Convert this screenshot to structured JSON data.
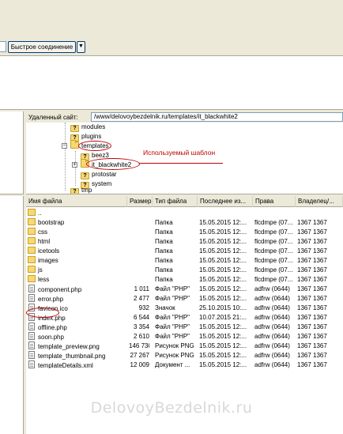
{
  "toolbar": {
    "quick_connect_label": "Быстрое соединение",
    "dropdown_glyph": "▼"
  },
  "remote": {
    "label": "Удаленный сайт:",
    "path": "/www/delovoybezdelnik.ru/templates/it_blackwhite2"
  },
  "tree": [
    {
      "label": "modules",
      "icon": "question-folder-icon"
    },
    {
      "label": "plugins",
      "icon": "question-folder-icon"
    },
    {
      "label": "templates",
      "icon": "folder-icon",
      "expanded": true
    },
    {
      "label": "beez3",
      "icon": "question-folder-icon"
    },
    {
      "label": "it_blackwhite2",
      "icon": "folder-icon",
      "expandable": true
    },
    {
      "label": "protostar",
      "icon": "question-folder-icon"
    },
    {
      "label": "system",
      "icon": "question-folder-icon"
    },
    {
      "label": "tmp",
      "icon": "question-folder-icon"
    }
  ],
  "annotation": "Используемый шаблон",
  "columns": [
    "Имя файла",
    "Размер",
    "Тип файла",
    "Последнее из...",
    "Права",
    "Владелец/..."
  ],
  "files": [
    {
      "name": "..",
      "size": "",
      "type": "",
      "date": "",
      "perm": "",
      "owner": "",
      "kind": "up"
    },
    {
      "name": "bootstrap",
      "size": "",
      "type": "Папка",
      "date": "15.05.2015 12:...",
      "perm": "flcdmpe (07...",
      "owner": "1367 1367",
      "kind": "folder"
    },
    {
      "name": "css",
      "size": "",
      "type": "Папка",
      "date": "15.05.2015 12:...",
      "perm": "flcdmpe (07...",
      "owner": "1367 1367",
      "kind": "folder"
    },
    {
      "name": "html",
      "size": "",
      "type": "Папка",
      "date": "15.05.2015 12:...",
      "perm": "flcdmpe (07...",
      "owner": "1367 1367",
      "kind": "folder"
    },
    {
      "name": "icetools",
      "size": "",
      "type": "Папка",
      "date": "15.05.2015 12:...",
      "perm": "flcdmpe (07...",
      "owner": "1367 1367",
      "kind": "folder"
    },
    {
      "name": "images",
      "size": "",
      "type": "Папка",
      "date": "15.05.2015 12:...",
      "perm": "flcdmpe (07...",
      "owner": "1367 1367",
      "kind": "folder"
    },
    {
      "name": "js",
      "size": "",
      "type": "Папка",
      "date": "15.05.2015 12:...",
      "perm": "flcdmpe (07...",
      "owner": "1367 1367",
      "kind": "folder"
    },
    {
      "name": "less",
      "size": "",
      "type": "Папка",
      "date": "15.05.2015 12:...",
      "perm": "flcdmpe (07...",
      "owner": "1367 1367",
      "kind": "folder"
    },
    {
      "name": "component.php",
      "size": "1 011",
      "type": "Файл \"PHP\"",
      "date": "15.05.2015 12:...",
      "perm": "adfrw (0644)",
      "owner": "1367 1367",
      "kind": "file"
    },
    {
      "name": "error.php",
      "size": "2 477",
      "type": "Файл \"PHP\"",
      "date": "15.05.2015 12:...",
      "perm": "adfrw (0644)",
      "owner": "1367 1367",
      "kind": "file"
    },
    {
      "name": "favicon.ico",
      "size": "932",
      "type": "Значок",
      "date": "25.10.2015 10:...",
      "perm": "adfrw (0644)",
      "owner": "1367 1367",
      "kind": "file"
    },
    {
      "name": "index.php",
      "size": "6 544",
      "type": "Файл \"PHP\"",
      "date": "10.07.2015 21:...",
      "perm": "adfrw (0644)",
      "owner": "1367 1367",
      "kind": "file"
    },
    {
      "name": "offline.php",
      "size": "3 354",
      "type": "Файл \"PHP\"",
      "date": "15.05.2015 12:...",
      "perm": "adfrw (0644)",
      "owner": "1367 1367",
      "kind": "file"
    },
    {
      "name": "soon.php",
      "size": "2 610",
      "type": "Файл \"PHP\"",
      "date": "15.05.2015 12:...",
      "perm": "adfrw (0644)",
      "owner": "1367 1367",
      "kind": "file"
    },
    {
      "name": "template_preview.png",
      "size": "146 730",
      "type": "Рисунок PNG",
      "date": "15.05.2015 12:...",
      "perm": "adfrw (0644)",
      "owner": "1367 1367",
      "kind": "file"
    },
    {
      "name": "template_thumbnail.png",
      "size": "27 267",
      "type": "Рисунок PNG",
      "date": "15.05.2015 12:...",
      "perm": "adfrw (0644)",
      "owner": "1367 1367",
      "kind": "file"
    },
    {
      "name": "templateDetails.xml",
      "size": "12 009",
      "type": "Документ ...",
      "date": "15.05.2015 12:...",
      "perm": "adfrw (0644)",
      "owner": "1367 1367",
      "kind": "file"
    }
  ],
  "watermark": "DelovoyBezdelnik.ru",
  "colors": {
    "annotation": "#c00000",
    "chrome": "#ece9d8",
    "folder": "#f8d775"
  }
}
